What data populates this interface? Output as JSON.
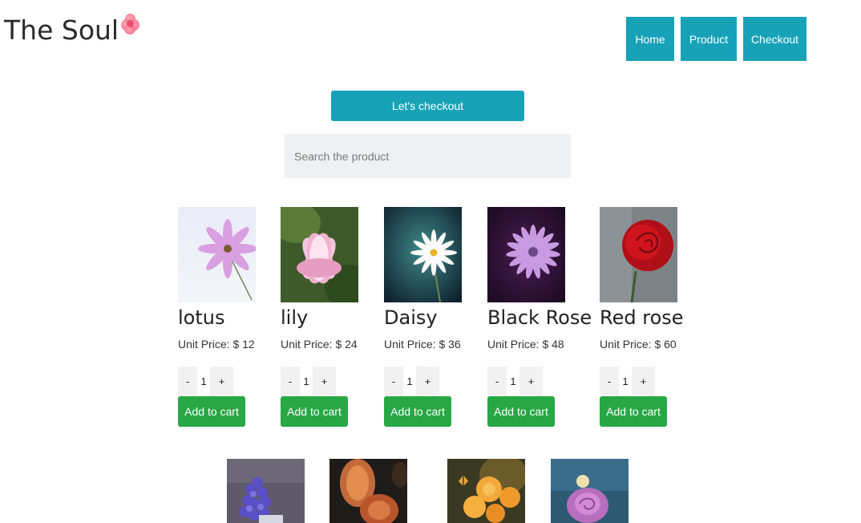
{
  "brand": {
    "name": "The Soul",
    "logo_icon": "rose-icon"
  },
  "nav": {
    "home": "Home",
    "product": "Product",
    "checkout": "Checkout"
  },
  "checkout_button": "Let's checkout",
  "search": {
    "placeholder": "Search the product",
    "value": ""
  },
  "products": [
    {
      "name": "lotus",
      "price": "Unit Price: $ 12",
      "qty": "1",
      "minus": "-",
      "plus": "+",
      "add": "Add to cart"
    },
    {
      "name": "lily",
      "price": "Unit Price: $ 24",
      "qty": "1",
      "minus": "-",
      "plus": "+",
      "add": "Add to cart"
    },
    {
      "name": "Daisy",
      "price": "Unit Price: $ 36",
      "qty": "1",
      "minus": "-",
      "plus": "+",
      "add": "Add to cart"
    },
    {
      "name": "Black Rose",
      "price": "Unit Price: $ 48",
      "qty": "1",
      "minus": "-",
      "plus": "+",
      "add": "Add to cart"
    },
    {
      "name": "Red rose",
      "price": "Unit Price: $ 60",
      "qty": "1",
      "minus": "-",
      "plus": "+",
      "add": "Add to cart"
    }
  ],
  "colors": {
    "primary": "#17a2b8",
    "success": "#28a745",
    "input_bg": "#eef0f1"
  }
}
